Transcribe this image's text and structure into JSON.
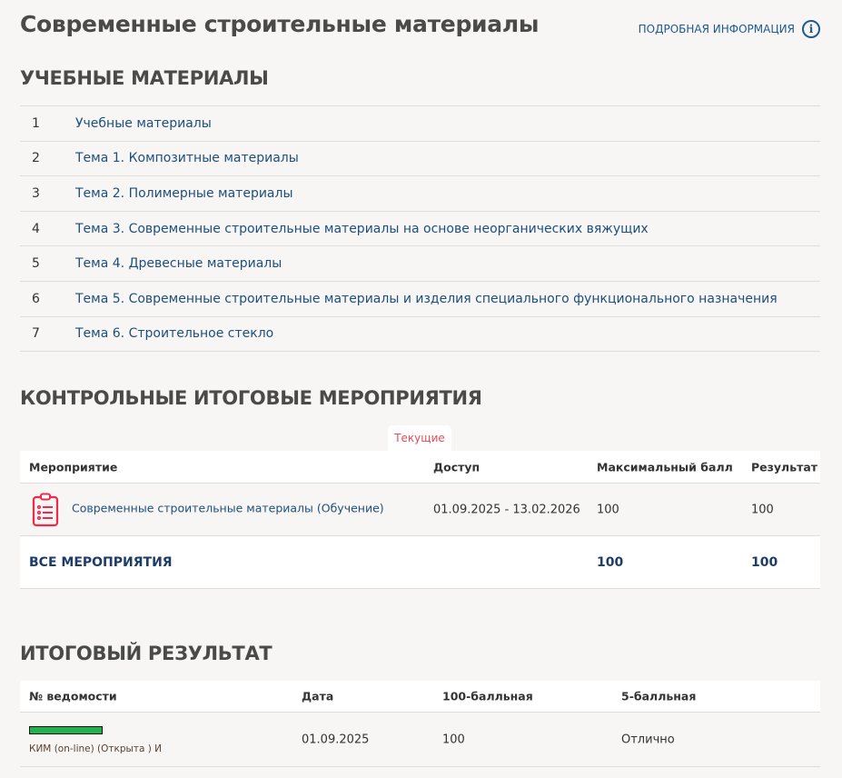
{
  "title": "Современные строительные материалы",
  "info_link": "ПОДРОБНАЯ ИНФОРМАЦИЯ",
  "materials": {
    "heading": "УЧЕБНЫЕ МАТЕРИАЛЫ",
    "items": [
      {
        "n": "1",
        "label": "Учебные материалы"
      },
      {
        "n": "2",
        "label": "Тема 1. Композитные материалы"
      },
      {
        "n": "3",
        "label": "Тема 2. Полимерные материалы"
      },
      {
        "n": "4",
        "label": "Тема 3. Современные строительные материалы на основе неорганических вяжущих"
      },
      {
        "n": "5",
        "label": "Тема 4. Древесные материалы"
      },
      {
        "n": "6",
        "label": "Тема 5. Современные строительные материалы и изделия специального функционального назначения"
      },
      {
        "n": "7",
        "label": "Тема 6. Строительное стекло"
      }
    ]
  },
  "control": {
    "heading": "КОНТРОЛЬНЫЕ ИТОГОВЫЕ МЕРОПРИЯТИЯ",
    "tab": "Текущие",
    "columns": [
      "Мероприятие",
      "Доступ",
      "Максимальный балл",
      "Результат"
    ],
    "row": {
      "name": "Современные строительные материалы (Обучение)",
      "access": "01.09.2025 - 13.02.2026",
      "max": "100",
      "result": "100"
    },
    "total": {
      "label": "ВСЕ МЕРОПРИЯТИЯ",
      "max": "100",
      "result": "100"
    }
  },
  "final": {
    "heading": "ИТОГОВЫЙ РЕЗУЛЬТАТ",
    "columns": [
      "№ ведомости",
      "Дата",
      "100-балльная",
      "5-балльная"
    ],
    "row": {
      "sheet": "КИМ (on-line) (Открыта ) И",
      "date": "01.09.2025",
      "score100": "100",
      "score5": "Отлично",
      "progress": 1.0,
      "bar_color": "#22b14c"
    }
  }
}
